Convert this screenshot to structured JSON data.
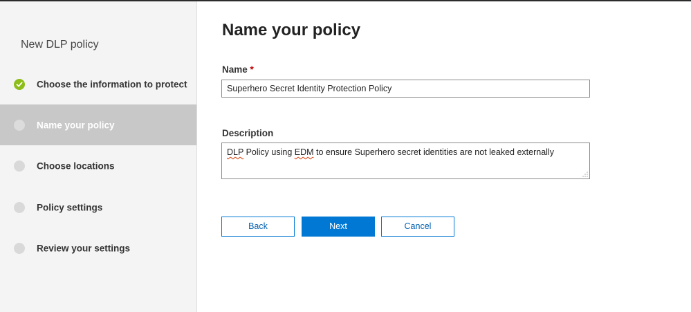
{
  "sidebar": {
    "title": "New DLP policy",
    "steps": [
      {
        "label": "Choose the information to protect",
        "state": "completed"
      },
      {
        "label": "Name your policy",
        "state": "current"
      },
      {
        "label": "Choose locations",
        "state": "pending"
      },
      {
        "label": "Policy settings",
        "state": "pending"
      },
      {
        "label": "Review your settings",
        "state": "pending"
      }
    ]
  },
  "main": {
    "title": "Name your policy",
    "name_field": {
      "label": "Name",
      "required_marker": "*",
      "value": "Superhero Secret Identity Protection Policy"
    },
    "description_field": {
      "label": "Description",
      "value_parts": {
        "w1": "DLP",
        "t1": " Policy using ",
        "w2": "EDM",
        "t2": " to ensure Superhero secret identities are not leaked externally"
      }
    },
    "buttons": {
      "back": "Back",
      "next": "Next",
      "cancel": "Cancel"
    }
  },
  "colors": {
    "accent": "#0078d4",
    "completed": "#8cbd18",
    "active_step_bg": "#c8c8c8",
    "required": "#c00000"
  },
  "icons": {
    "completed_step": "checkmark-icon",
    "pending_step": "circle-icon",
    "textarea_resize": "resize-grip-icon"
  }
}
